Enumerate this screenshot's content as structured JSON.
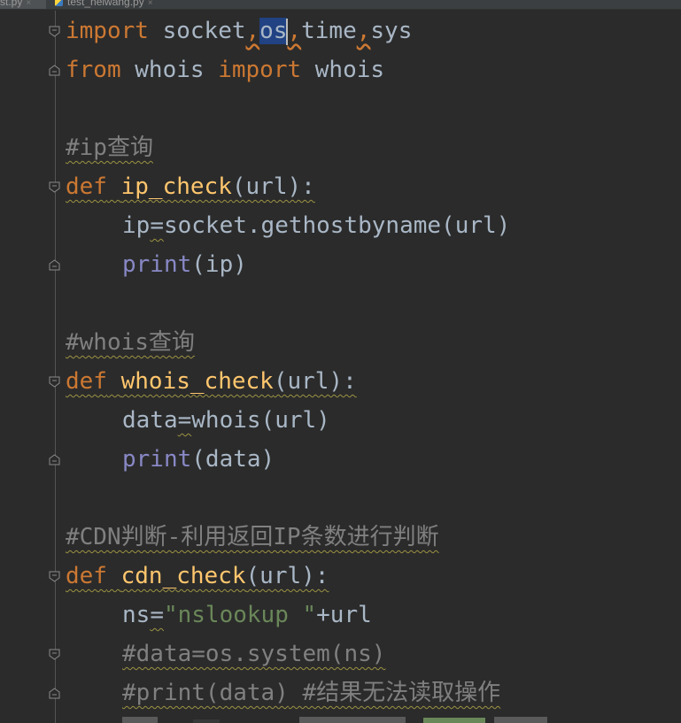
{
  "tabs": [
    {
      "label": "st.py",
      "close": "×"
    },
    {
      "label": "test_neiwang.py",
      "close": "×"
    }
  ],
  "editor": {
    "line1": {
      "import": "import",
      "socket": " socket",
      "comma1": ",",
      "os": "os",
      "comma2": ",",
      "time": "time",
      "comma3": ",",
      "sys": "sys"
    },
    "line2": {
      "from": "from",
      "whois_mod": " whois ",
      "import": "import",
      "whois_name": " whois"
    },
    "line4": {
      "comment": "#ip查询"
    },
    "line5": {
      "def": "def",
      "fname": "ip_check",
      "args": "(url):"
    },
    "line6": {
      "var": "ip",
      "eq": "=",
      "rest": "socket.gethostbyname(url)"
    },
    "line7": {
      "print": "print",
      "args": "(ip)"
    },
    "line9": {
      "comment": "#whois查询"
    },
    "line10": {
      "def": "def",
      "fname": "whois_check",
      "args": "(url):"
    },
    "line11": {
      "var": "data",
      "eq": "=",
      "rest": "whois(url)"
    },
    "line12": {
      "print": "print",
      "args": "(data)"
    },
    "line14": {
      "comment": "#CDN判断-利用返回IP条数进行判断"
    },
    "line15": {
      "def": "def",
      "fname": "cdn_check",
      "args": "(url):"
    },
    "line16": {
      "var": "ns",
      "eq": "=",
      "str": "\"nslookup \"",
      "rest": "+url"
    },
    "line17": {
      "comment": "#data=os.system(ns)"
    },
    "line18": {
      "comment1": "#print(data)",
      "comment2": " #结果无法读取操作"
    }
  },
  "colors": {
    "background": "#2b2b2b",
    "keyword": "#cc7832",
    "function": "#ffc66d",
    "builtin": "#8888c6",
    "string": "#6a8759",
    "comment": "#808080",
    "text": "#a9b7c6",
    "selection": "#214283"
  }
}
